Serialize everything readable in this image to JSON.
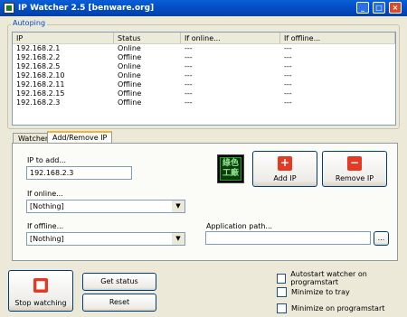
{
  "window": {
    "title": "IP Watcher 2.5 [benware.org]",
    "min": "_",
    "max": "□",
    "close": "×"
  },
  "autoping": {
    "label": "Autoping",
    "columns": [
      "IP",
      "Status",
      "If online...",
      "If offline..."
    ],
    "rows": [
      [
        "192.168.2.1",
        "Online",
        "---",
        "---"
      ],
      [
        "192.168.2.2",
        "Offline",
        "---",
        "---"
      ],
      [
        "192.168.2.5",
        "Online",
        "---",
        "---"
      ],
      [
        "192.168.2.10",
        "Online",
        "---",
        "---"
      ],
      [
        "192.168.2.11",
        "Offline",
        "---",
        "---"
      ],
      [
        "192.168.2.15",
        "Offline",
        "---",
        "---"
      ],
      [
        "192.168.2.3",
        "Offline",
        "---",
        "---"
      ]
    ]
  },
  "tabs": {
    "watcher": "Watcher",
    "add_remove": "Add/Remove IP"
  },
  "form": {
    "ip_label": "IP to add...",
    "ip_value": "192.168.2.3",
    "online_label": "If online...",
    "online_value": "[Nothing]",
    "offline_label": "If offline...",
    "offline_value": "[Nothing]",
    "app_path_label": "Application path...",
    "app_path_value": "",
    "browse_label": "...",
    "add_ip_label": "Add IP",
    "remove_ip_label": "Remove IP",
    "logo_text": "綠色\n工廠"
  },
  "bottom": {
    "stop_label": "Stop watching",
    "get_status_label": "Get status",
    "reset_label": "Reset",
    "autostart_label": "Autostart watcher on programstart",
    "tray_label": "Minimize to tray",
    "minimize_start_label": "Minimize on programstart"
  },
  "colors": {
    "accent": "#0046d5",
    "add": "#e43a24",
    "remove": "#e43a24",
    "stop": "#e43a24"
  }
}
